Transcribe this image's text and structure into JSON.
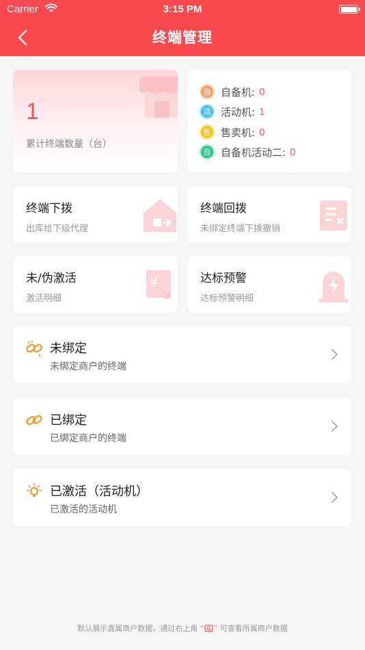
{
  "status_bar": {
    "carrier": "Carrier",
    "time": "3:15 PM"
  },
  "nav": {
    "title": "终端管理"
  },
  "summary": {
    "count": "1",
    "label": "累计终端数量（台）"
  },
  "types": [
    {
      "badge": "自",
      "name": "自备机:",
      "value": "0",
      "color": "#f2a36a"
    },
    {
      "badge": "活",
      "name": "活动机:",
      "value": "1",
      "color": "#47bff0"
    },
    {
      "badge": "售",
      "name": "售卖机:",
      "value": "0",
      "color": "#f5c518"
    },
    {
      "badge": "自",
      "name": "自备机活动二:",
      "value": "0",
      "color": "#29c98e"
    }
  ],
  "tiles": [
    {
      "title": "终端下拨",
      "subtitle": "出库给下级代理",
      "icon": "house-transfer-icon"
    },
    {
      "title": "终端回拨",
      "subtitle": "未绑定终端下拨撤销",
      "icon": "document-cancel-icon"
    },
    {
      "title": "未/伪激活",
      "subtitle": "激活明细",
      "icon": "yuan-card-icon"
    },
    {
      "title": "达标预警",
      "subtitle": "达标预警明细",
      "icon": "alarm-light-icon"
    }
  ],
  "list": [
    {
      "title": "未绑定",
      "subtitle": "未绑定商户的终端",
      "icon": "broken-link-icon"
    },
    {
      "title": "已绑定",
      "subtitle": "已绑定商户的终端",
      "icon": "link-icon"
    },
    {
      "title": "已激活（活动机）",
      "subtitle": "已激活的活动机",
      "icon": "lightbulb-icon"
    }
  ],
  "footer": {
    "before": "默认展示直属商户数据，通过右上角 “",
    "after": "” 可查看所属商户数据"
  },
  "colors": {
    "brand": "#f8494f",
    "accent": "#f2545b",
    "orange": "#f59a2f"
  }
}
